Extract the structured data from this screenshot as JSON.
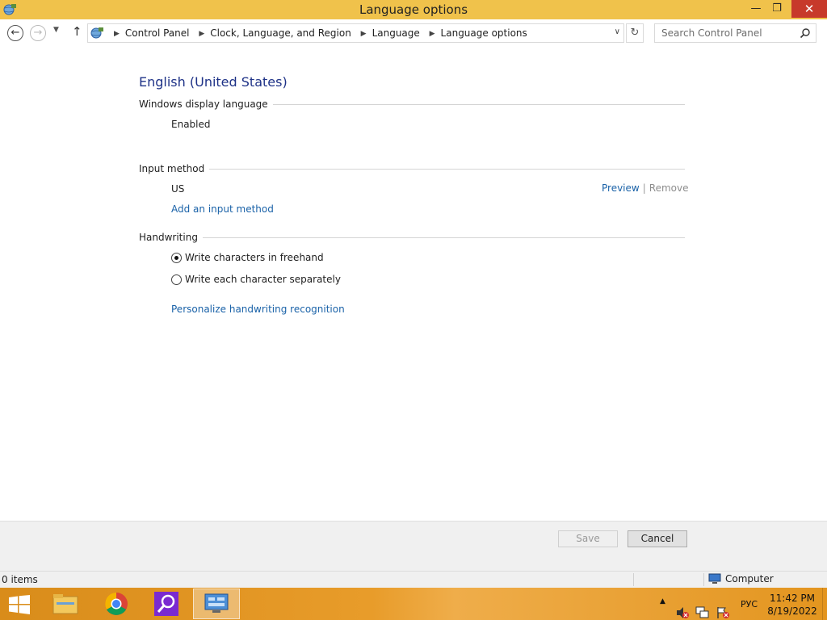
{
  "window": {
    "title": "Language options",
    "min_glyph": "—",
    "max_glyph": "❐",
    "close_glyph": "✕"
  },
  "nav": {
    "back_glyph": "←",
    "forward_glyph": "→",
    "recent_glyph": "▼",
    "up_glyph": "↑",
    "breadcrumbs": [
      "Control Panel",
      "Clock, Language, and Region",
      "Language",
      "Language options"
    ],
    "separator_glyph": "▶",
    "dropdown_glyph": "∨",
    "refresh_glyph": "↻",
    "search_placeholder": "Search Control Panel"
  },
  "content": {
    "language_title": "English (United States)",
    "display_section": {
      "header": "Windows display language",
      "status": "Enabled"
    },
    "input_section": {
      "header": "Input method",
      "method": "US",
      "preview_link": "Preview",
      "separator": "|",
      "remove_link": "Remove",
      "add_link": "Add an input method"
    },
    "handwriting_section": {
      "header": "Handwriting",
      "options": [
        {
          "label": "Write characters in freehand",
          "selected": true
        },
        {
          "label": "Write each character separately",
          "selected": false
        }
      ],
      "personalize_link": "Personalize handwriting recognition"
    }
  },
  "buttons": {
    "save_label": "Save",
    "cancel_label": "Cancel"
  },
  "statusbar": {
    "items_text": "0 items",
    "location_text": "Computer"
  },
  "taskbar": {
    "tray_arrow_glyph": "▲",
    "language_indicator": "РУС",
    "time": "11:42 PM",
    "date": "8/19/2022"
  },
  "colors": {
    "titlebar": "#f0c24b",
    "link": "#1a62a8",
    "heading": "#1e3287",
    "taskbar": "#e89c2a",
    "close_button": "#c7392b"
  }
}
